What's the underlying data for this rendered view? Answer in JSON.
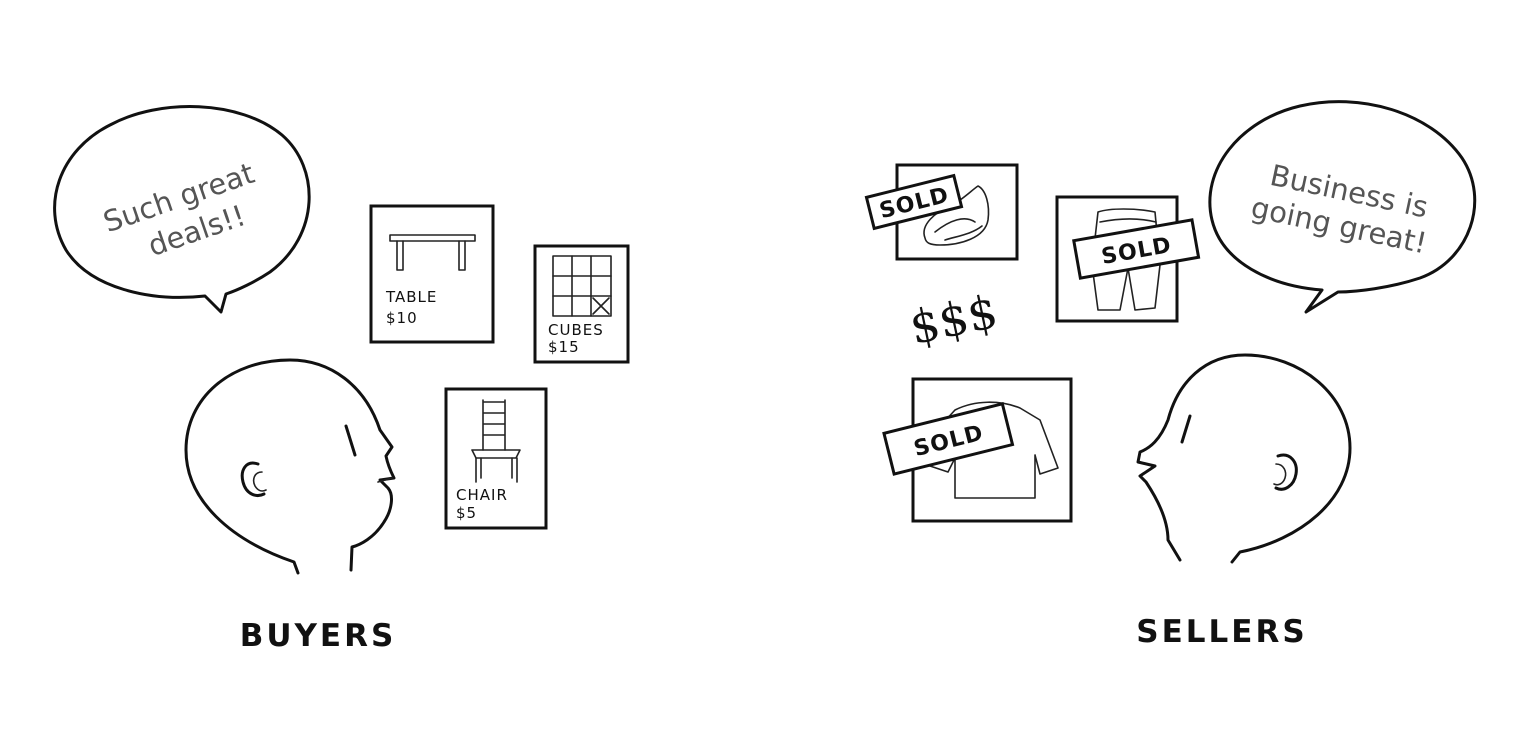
{
  "buyers": {
    "label": "BUYERS",
    "speech_line1": "Such great",
    "speech_line2": "deals!!",
    "items": [
      {
        "name": "TABLE",
        "price": "$10",
        "icon": "table-icon"
      },
      {
        "name": "CUBES",
        "price": "$15",
        "icon": "cubes-shelf-icon"
      },
      {
        "name": "CHAIR",
        "price": "$5",
        "icon": "chair-icon"
      }
    ]
  },
  "sellers": {
    "label": "SELLERS",
    "speech_line1": "Business is",
    "speech_line2": "going great!",
    "money": "$$$",
    "sold_items": [
      {
        "stamp": "SOLD",
        "icon": "shoe-icon"
      },
      {
        "stamp": "SOLD",
        "icon": "pants-icon"
      },
      {
        "stamp": "SOLD",
        "icon": "shirt-icon"
      }
    ]
  },
  "colors": {
    "ink": "#111111",
    "speech_text": "#555555",
    "background": "#ffffff"
  }
}
